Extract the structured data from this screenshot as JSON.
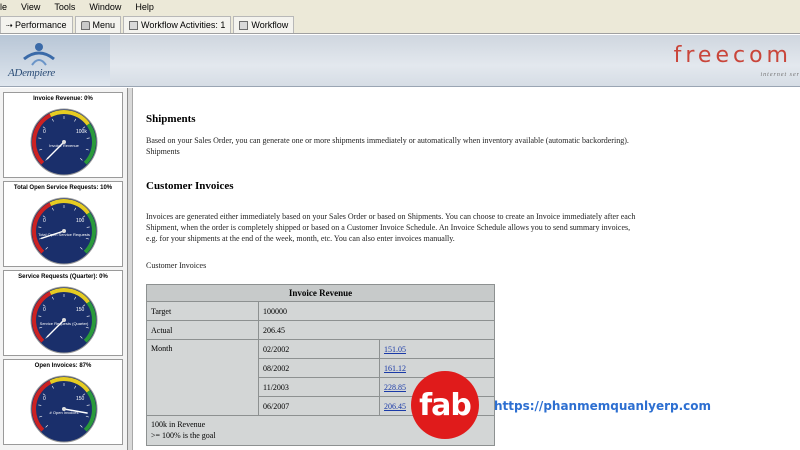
{
  "menu": [
    "le",
    "View",
    "Tools",
    "Window",
    "Help"
  ],
  "tabs": [
    {
      "label": "Performance",
      "icon": "performance-icon"
    },
    {
      "label": "Menu",
      "icon": "home-icon"
    },
    {
      "label": "Workflow Activities: 1",
      "icon": "checkbox-icon"
    },
    {
      "label": "Workflow",
      "icon": "workflow-icon"
    }
  ],
  "banner": {
    "logo_text": "ADempiere",
    "brand": "freecom",
    "brand_sub": "internet ser"
  },
  "gauges": [
    {
      "title": "Invoice Revenue: 0%",
      "center_label": "Invoice Revenue",
      "max": "100k",
      "value": 0.0
    },
    {
      "title": "Total Open Service Requests: 10%",
      "center_label": "Total Open Service Requests",
      "max": "100",
      "value": 0.1
    },
    {
      "title": "Service Requests (Quarter): 0%",
      "center_label": "Service Requests (Quarter)",
      "max": "150",
      "value": 0.0
    },
    {
      "title": "Open Invoices: 87%",
      "center_label": "# Open Invoices",
      "max": "150",
      "value": 0.87
    }
  ],
  "content": {
    "shipments_heading": "Shipments",
    "shipments_text_1": "Based on your Sales Order, you can generate one or more shipments immediately or automatically when inventory available (automatic backordering).",
    "shipments_text_2": "Shipments",
    "invoices_heading": "Customer Invoices",
    "invoices_text_1": "Invoices are generated either immediately based on your Sales Order or based on Shipments. You can choose to create an Invoice immediately after each",
    "invoices_text_2": "Shipment, when the order is completely shipped or based on a Customer Invoice Schedule. An Invoice Schedule allows you to send summary invoices,",
    "invoices_text_3": "e.g. for your shipments at the end of the week, month, etc. You can also enter invoices manually.",
    "invoices_link_label": "Customer Invoices",
    "table": {
      "title": "Invoice Revenue",
      "target_label": "Target",
      "target_value": "100000",
      "actual_label": "Actual",
      "actual_value": "206.45",
      "month_label": "Month",
      "months": [
        {
          "month": "02/2002",
          "value": "151.05"
        },
        {
          "month": "08/2002",
          "value": "161.12"
        },
        {
          "month": "11/2003",
          "value": "228.85"
        },
        {
          "month": "06/2007",
          "value": "206.45"
        }
      ],
      "foot_1": "100k in Revenue",
      "foot_2": ">= 100% is the goal"
    }
  },
  "overlay": {
    "badge": "fab",
    "url": "https://phanmemquanlyerp.com"
  },
  "colors": {
    "gauge_face": "#1a2f6b",
    "gauge_red": "#cc2222",
    "gauge_yellow": "#e6cc22",
    "gauge_green": "#2a9a3a",
    "brand": "#c9453a",
    "badge": "#e01b1b",
    "url": "#2d6fd1"
  }
}
